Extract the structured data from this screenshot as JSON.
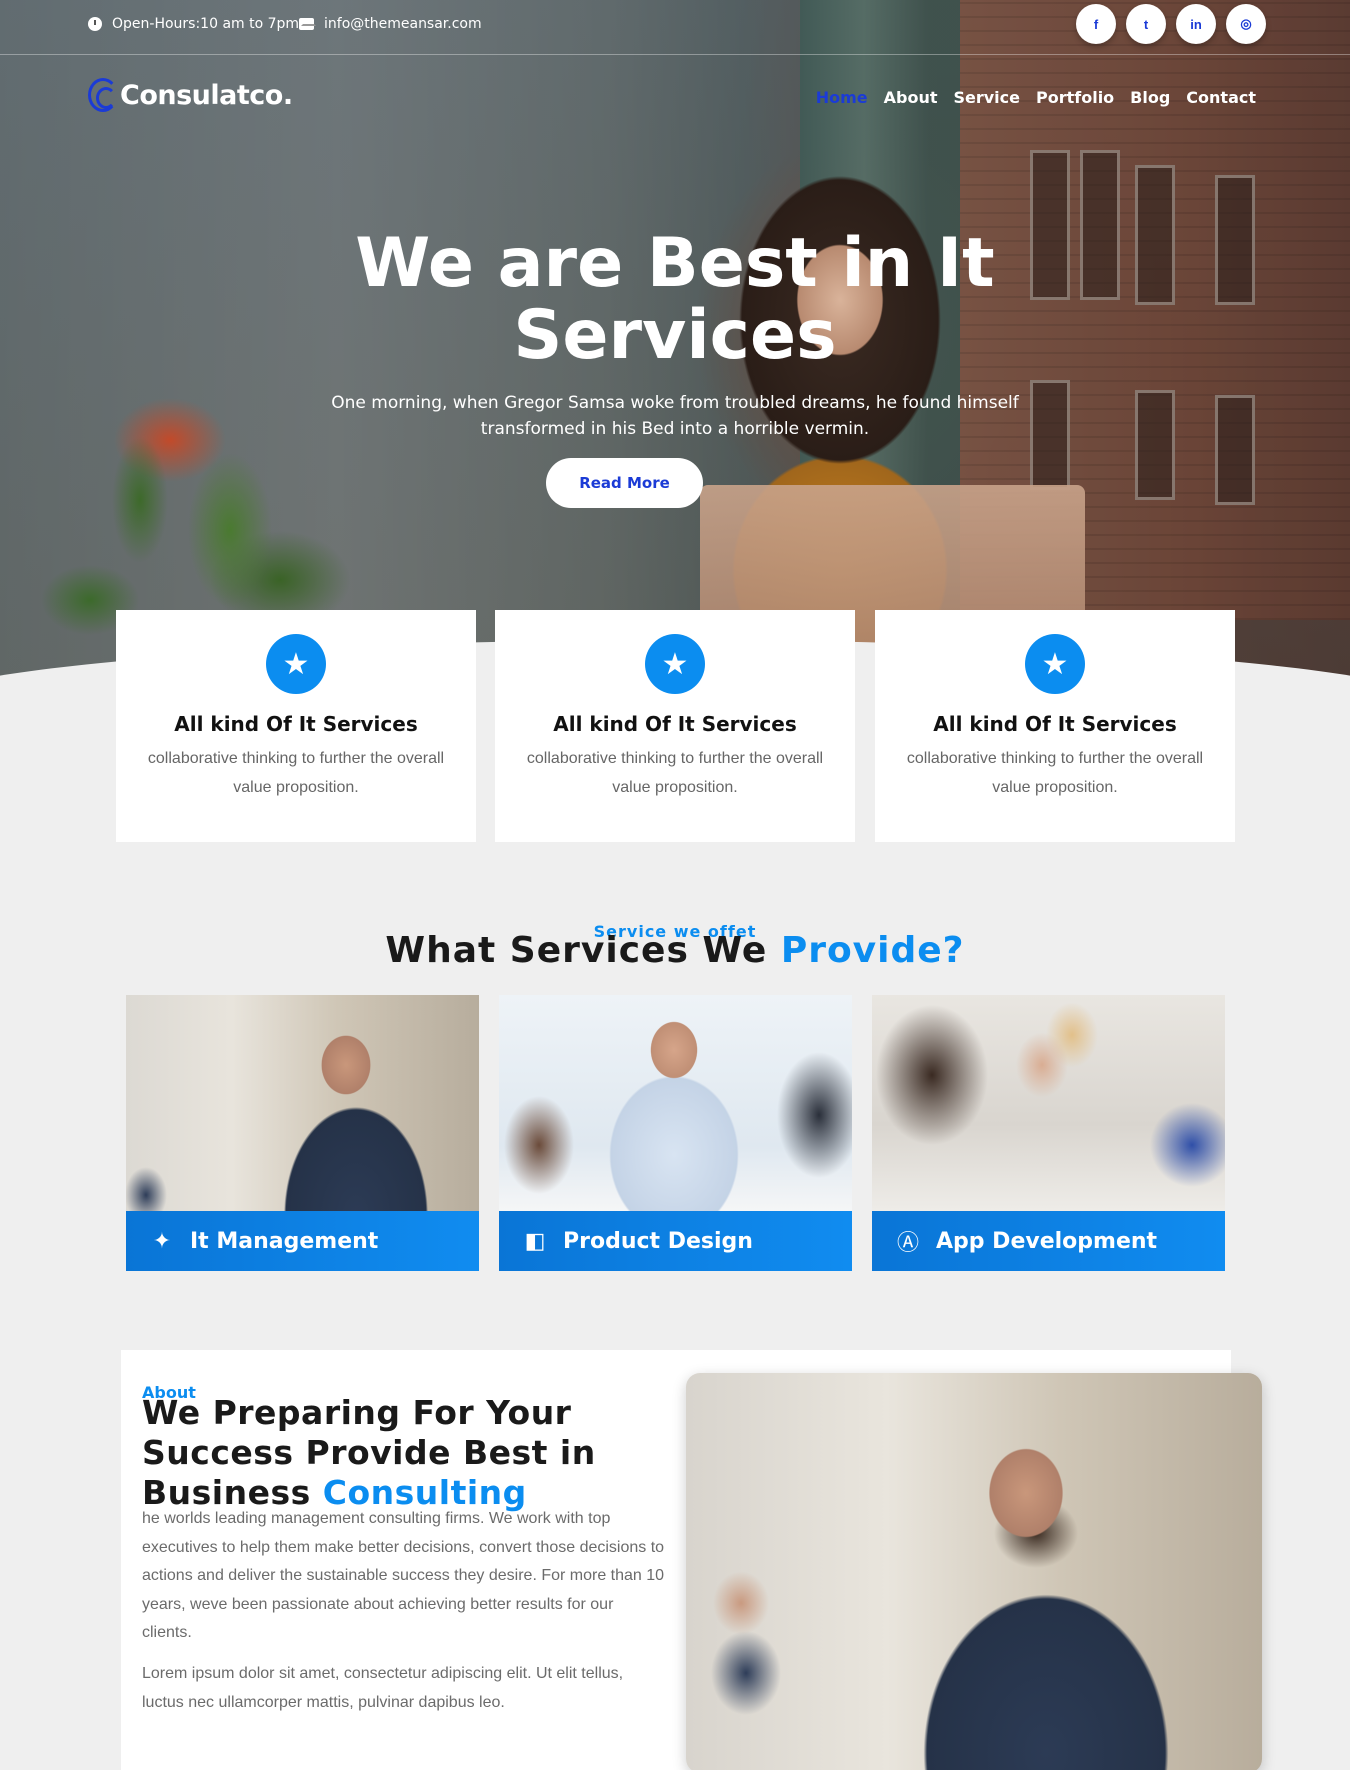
{
  "topbar": {
    "hours": "Open-Hours:10 am to 7pm",
    "email": "info@themeansar.com",
    "socials": [
      {
        "icon": "facebook-icon",
        "glyph": "f"
      },
      {
        "icon": "twitter-icon",
        "glyph": "t"
      },
      {
        "icon": "linkedin-icon",
        "glyph": "in"
      },
      {
        "icon": "instagram-icon",
        "glyph": "◎"
      }
    ]
  },
  "brand": {
    "name": "Consulatco."
  },
  "nav": {
    "items": [
      "Home",
      "About",
      "Service",
      "Portfolio",
      "Blog",
      "Contact"
    ],
    "active": "Home"
  },
  "hero": {
    "title_line1": "We are Best in It",
    "title_line2": "Services",
    "subtitle_line1": "One morning, when Gregor Samsa woke from troubled dreams, he found himself",
    "subtitle_line2": "transformed in his Bed into a horrible vermin.",
    "button": "Read More"
  },
  "features": [
    {
      "icon": "star-icon",
      "title": "All kind Of It Services",
      "text": "collaborative thinking to further the overall value proposition."
    },
    {
      "icon": "star-icon",
      "title": "All kind Of It Services",
      "text": "collaborative thinking to further the overall value proposition."
    },
    {
      "icon": "star-icon",
      "title": "All kind Of It Services",
      "text": "collaborative thinking to further the overall value proposition."
    }
  ],
  "services": {
    "eyebrow": "Service we offet",
    "title": "What Services We",
    "title_accent": "Provide?",
    "cards": [
      {
        "icon": "magic-wand-icon",
        "label": "It Management"
      },
      {
        "icon": "flipboard-icon",
        "label": "Product Design"
      },
      {
        "icon": "app-store-icon",
        "label": "App Development"
      }
    ]
  },
  "about": {
    "eyebrow": "About",
    "title": "We Preparing For Your Success Provide Best in Business",
    "title_accent": "Consulting",
    "paragraph1": "he worlds leading management consulting firms. We work with top executives to help them make better decisions, convert those decisions to actions and deliver the sustainable success they desire. For more than 10 years, weve been passionate about achieving better results for our clients.",
    "paragraph2": "Lorem ipsum dolor sit amet, consectetur adipiscing elit. Ut elit tellus, luctus nec ullamcorper mattis, pulvinar dapibus leo."
  },
  "colors": {
    "accent": "#0b8df0",
    "nav_active": "#1b3bd6",
    "background": "#efefef"
  }
}
